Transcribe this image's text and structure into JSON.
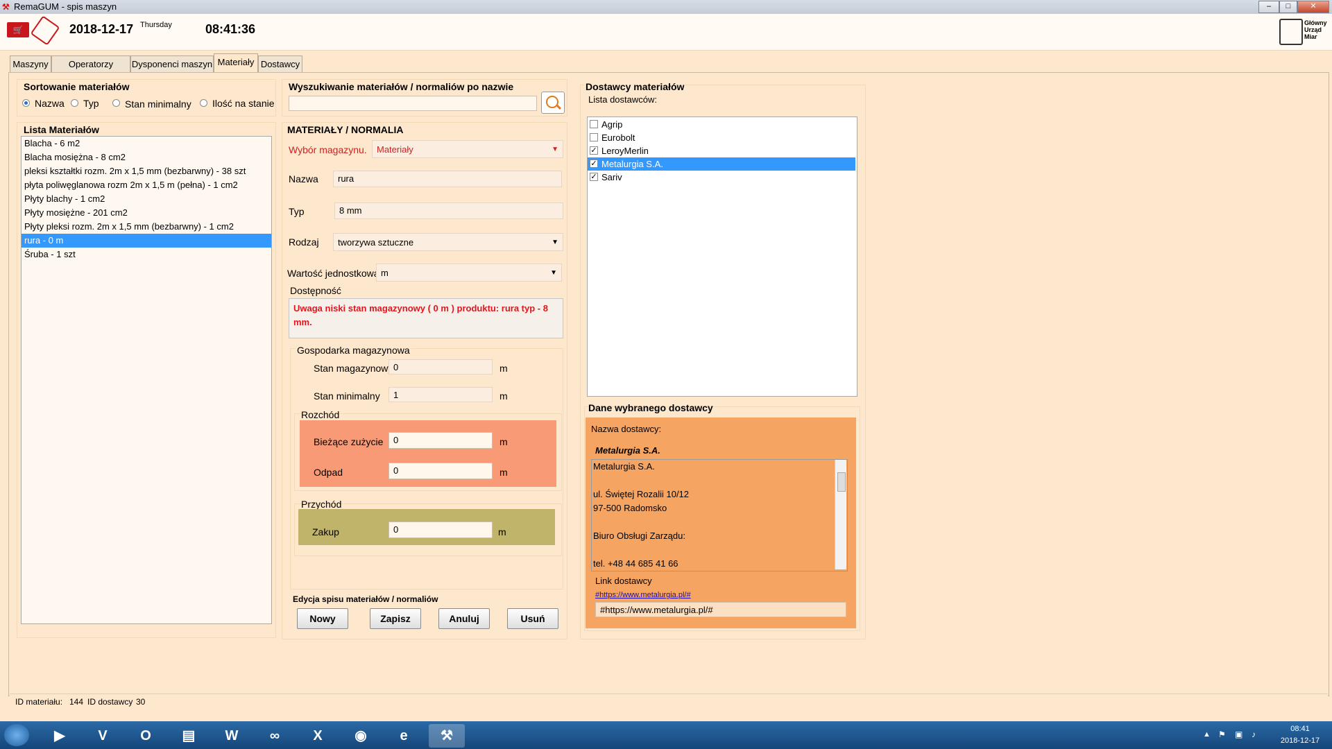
{
  "window": {
    "title": "RemaGUM - spis maszyn"
  },
  "header": {
    "date": "2018-12-17",
    "day": "Thursday",
    "time": "08:41:36",
    "logo_text": "Główny Urząd Miar"
  },
  "tabs": [
    {
      "label": "Maszyny"
    },
    {
      "label": "Operatorzy maszyn"
    },
    {
      "label": "Dysponenci maszyn"
    },
    {
      "label": "Materiały"
    },
    {
      "label": "Dostawcy"
    }
  ],
  "sorting": {
    "title": "Sortowanie materiałów",
    "options": [
      {
        "label": "Nazwa",
        "selected": true
      },
      {
        "label": "Typ",
        "selected": false
      },
      {
        "label": "Stan minimalny",
        "selected": false
      },
      {
        "label": "Ilość na stanie",
        "selected": false
      }
    ]
  },
  "search": {
    "title": "Wyszukiwanie materiałów / normaliów po nazwie",
    "value": ""
  },
  "materials_list": {
    "title": "Lista Materiałów",
    "items": [
      "Blacha - 6 m2",
      "Blacha mosiężna - 8 cm2",
      "pleksi kształtki rozm. 2m x 1,5 mm (bezbarwny) - 38 szt",
      "płyta poliwęglanowa rozm 2m x 1,5 m (pełna) - 1 cm2",
      "Płyty blachy - 1 cm2",
      "Płyty mosiężne - 201 cm2",
      "Płyty pleksi rozm. 2m x 1,5 mm (bezbarwny) - 1 cm2",
      "rura - 0 m",
      "Śruba - 1 szt"
    ],
    "selected_index": 7
  },
  "form": {
    "title": "MATERIAŁY / NORMALIA",
    "warehouse_label": "Wybór magazynu.",
    "warehouse_value": "Materiały",
    "name_label": "Nazwa",
    "name_value": "rura",
    "type_label": "Typ",
    "type_value": "8 mm",
    "kind_label": "Rodzaj",
    "kind_value": "tworzywa sztuczne",
    "unit_label": "Wartość jednostkowa",
    "unit_value": "m",
    "availability_label": "Dostępność",
    "availability_warning": "Uwaga niski stan magazynowy ( 0 m ) produktu: rura typ - 8 mm."
  },
  "stock": {
    "title": "Gospodarka magazynowa",
    "stan_label": "Stan magazynowy",
    "stan_value": "0",
    "min_label": "Stan minimalny",
    "min_value": "1",
    "unit": "m",
    "rozchod": {
      "title": "Rozchód",
      "zuzycie_label": "Bieżące zużycie",
      "zuzycie_value": "0",
      "odpad_label": "Odpad",
      "odpad_value": "0"
    },
    "przychod": {
      "title": "Przychód",
      "zakup_label": "Zakup",
      "zakup_value": "0"
    }
  },
  "edit": {
    "title": "Edycja spisu materiałów / normaliów",
    "buttons": [
      "Nowy",
      "Zapisz",
      "Anuluj",
      "Usuń"
    ]
  },
  "suppliers": {
    "title": "Dostawcy materiałów",
    "list_label": "Lista dostawców:",
    "items": [
      {
        "name": "Agrip",
        "checked": false
      },
      {
        "name": "Eurobolt",
        "checked": false
      },
      {
        "name": "LeroyMerlin",
        "checked": true
      },
      {
        "name": "Metalurgia S.A.",
        "checked": true
      },
      {
        "name": "Sariv",
        "checked": true
      }
    ],
    "selected_index": 3
  },
  "supplier_details": {
    "title": "Dane wybranego dostawcy",
    "name_label": "Nazwa dostawcy:",
    "name_value": "Metalurgia S.A.",
    "address_lines": [
      "Metalurgia S.A.",
      "",
      "ul. Świętej Rozalii 10/12",
      "97-500 Radomsko",
      "",
      "Biuro Obsługi Zarządu:",
      "",
      "tel. +48 44 685 41 66"
    ],
    "link_label": "Link dostawcy",
    "link_value": "#https://www.metalurgia.pl/#",
    "link_input_value": "#https://www.metalurgia.pl/#"
  },
  "statusbar": {
    "id_material_label": "ID materiału:",
    "id_material_value": "144",
    "id_supplier_label": "ID dostawcy",
    "id_supplier_value": "30"
  },
  "taskbar": {
    "time": "08:41",
    "date": "2018-12-17"
  }
}
